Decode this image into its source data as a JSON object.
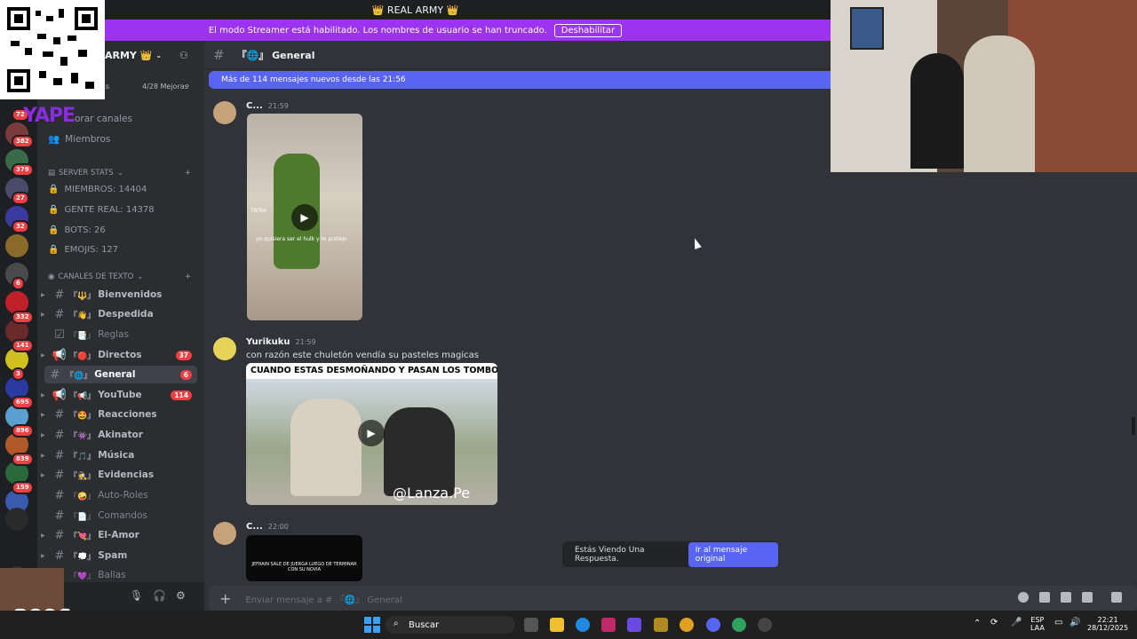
{
  "window": {
    "title": "👑 REAL ARMY 👑"
  },
  "streamer": {
    "notice": "El modo Streamer está habilitado. Los nombres de usuario se han truncado.",
    "button": "Deshabilitar"
  },
  "overlay": {
    "qr_label": "QR",
    "yape": "YAPE",
    "cam_label": "x2006"
  },
  "server": {
    "name": "ARMY 👑",
    "boosts": "4/28 Mejoras",
    "boosts_left": "as"
  },
  "rail_badges": [
    "72",
    "382",
    "379",
    "27",
    "32",
    "6",
    "332",
    "141",
    "3",
    "695",
    "896",
    "839",
    "159"
  ],
  "nav": {
    "browse": "orar canales",
    "members": "Miembros"
  },
  "stats": {
    "category": "SERVER STATS",
    "items": [
      "MIEMBROS: 14404",
      "GENTE REAL: 14378",
      "BOTS: 26",
      "EMOJIS: 127"
    ]
  },
  "text_channels": {
    "category": "CANALES DE TEXTO",
    "items": [
      {
        "name": "Bienvenidos",
        "deco": "『🔱』",
        "badge": ""
      },
      {
        "name": "Despedida",
        "deco": "『👋』",
        "badge": ""
      },
      {
        "name": "Reglas",
        "deco": "『📑』",
        "badge": ""
      },
      {
        "name": "Directos",
        "deco": "『🔴』",
        "badge": "37"
      },
      {
        "name": "General",
        "deco": "『🌐』",
        "badge": "6"
      },
      {
        "name": "YouTube",
        "deco": "『📢』",
        "badge": "114"
      },
      {
        "name": "Reacciones",
        "deco": "『🤩』",
        "badge": ""
      },
      {
        "name": "Akinator",
        "deco": "『👾』",
        "badge": ""
      },
      {
        "name": "Música",
        "deco": "『🎵』",
        "badge": ""
      },
      {
        "name": "Evidencias",
        "deco": "『🕵』",
        "badge": ""
      },
      {
        "name": "Auto-Roles",
        "deco": "『🤪』",
        "badge": ""
      },
      {
        "name": "Comandos",
        "deco": "『📄』",
        "badge": ""
      },
      {
        "name": "El-Amor",
        "deco": "『💘』",
        "badge": ""
      },
      {
        "name": "Spam",
        "deco": "『💭』",
        "badge": ""
      },
      {
        "name": "Ballas",
        "deco": "『💜』",
        "badge": ""
      }
    ]
  },
  "chat": {
    "channel": "『🌐』 General",
    "new_messages": "Más de 114 mensajes nuevos desde las 21:56",
    "messages": [
      {
        "author": "C...",
        "time": "21:59",
        "text": "",
        "video_caption": "yo quisiera ser el hulk y te protejo",
        "video_watermark": "TikTok"
      },
      {
        "author": "Yurikuku",
        "time": "21:59",
        "text": "con razón este chuletón vendía su pasteles magicas",
        "video_caption": "CUANDO ESTAS DESMOÑANDO Y PASAN  LOS TOMBOS",
        "video_watermark": "@Lanza.Pe"
      },
      {
        "author": "C...",
        "time": "22:00",
        "text": "",
        "video_caption": "JEFRAIN SALE DE JUERGA LUEGO DE TERMINAR CON SU NOVIA",
        "video_watermark": ""
      }
    ],
    "reply_notice": "Estás Viendo Una Respuesta.",
    "reply_button": "Ir al mensaje original",
    "composer_placeholder": "Enviar mensaje a # 『🌐』 General"
  },
  "taskbar": {
    "search": "Buscar",
    "lang": "ESP",
    "lang2": "LAA",
    "time": "22:21",
    "date": "28/12/2025"
  }
}
